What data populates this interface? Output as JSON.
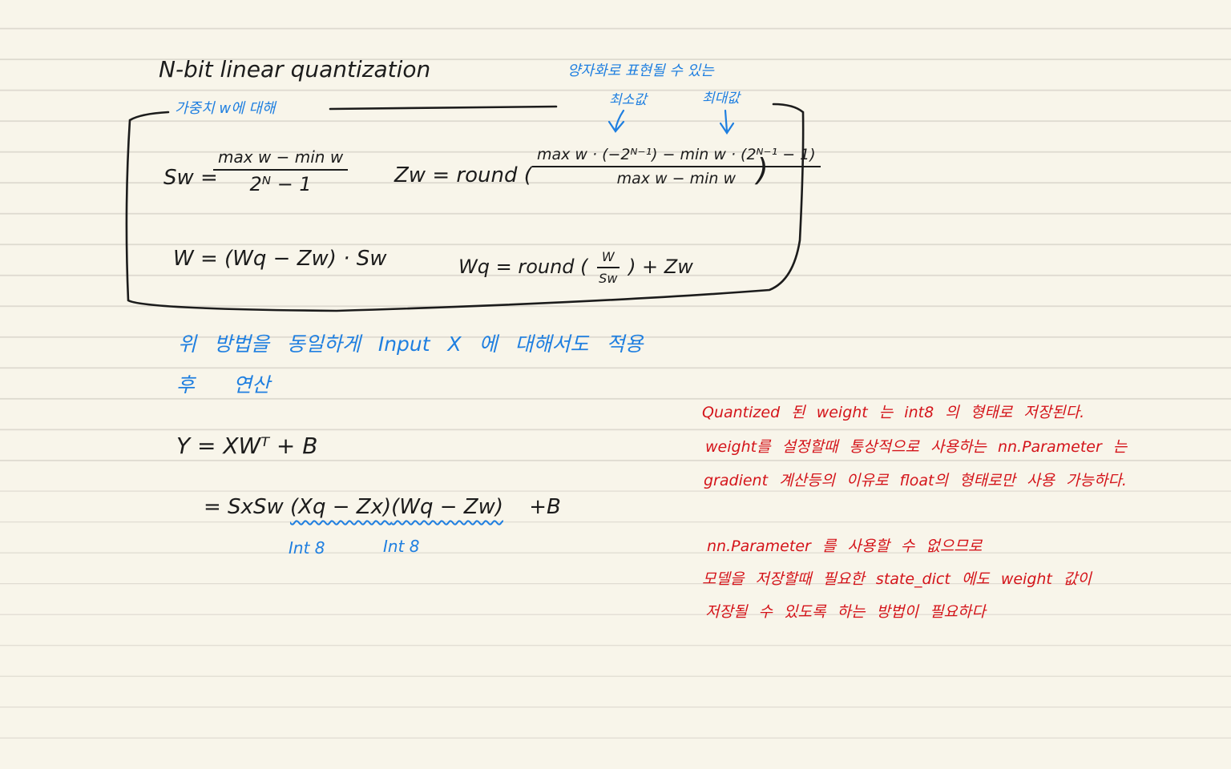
{
  "title": "N-bit  linear  quantization",
  "box_label": "가중치 w에 대해",
  "annotations": {
    "representable": "양자화로 표현될 수 있는",
    "min_value": "최소값",
    "max_value": "최대값"
  },
  "formulas": {
    "sw_lhs": "Sw =",
    "sw_num": "max w − min w",
    "sw_den": "2ᴺ − 1",
    "zw_lhs": "Zw = round (",
    "zw_num": "max w · (−2ᴺ⁻¹) − min w · (2ᴺ⁻¹ − 1)",
    "zw_den": "max w   − min w",
    "zw_close": ")",
    "w_dequant": "W = (Wq − Zw) · Sw",
    "wq_lhs": "Wq = round (",
    "wq_num": "W",
    "wq_den": "Sw",
    "wq_rhs": ") + Zw"
  },
  "note_blue_1": "위 방법을 동일하게 Input X 에 대해서도 적용",
  "note_blue_2": "후 연산",
  "y_eq_1": "Y = XWᵀ + B",
  "y_eq_2_prefix": "= SxSw",
  "y_eq_2_xterm": "(Xq − Zx)",
  "y_eq_2_wterm": "(Wq − Zw)",
  "y_eq_2_suffix": "+B",
  "int8_label_1": "Int 8",
  "int8_label_2": "Int 8",
  "red_notes": [
    "Quantized 된 weight 는 int8 의 형태로 저장된다.",
    "weight를 설정할때 통상적으로 사용하는 nn.Parameter 는",
    "gradient 계산등의 이유로 float의 형태로만 사용 가능하다.",
    "nn.Parameter 를 사용할 수 없으므로",
    "모델을 저장할때 필요한 state_dict 에도 weight 값이",
    "저장될 수 있도록 하는 방법이 필요하다"
  ],
  "colors": {
    "paper": "#f8f5ea",
    "rule": "#dedad0",
    "ink": "#1c1c1c",
    "blue": "#1f7fe0",
    "red": "#d4141a"
  }
}
